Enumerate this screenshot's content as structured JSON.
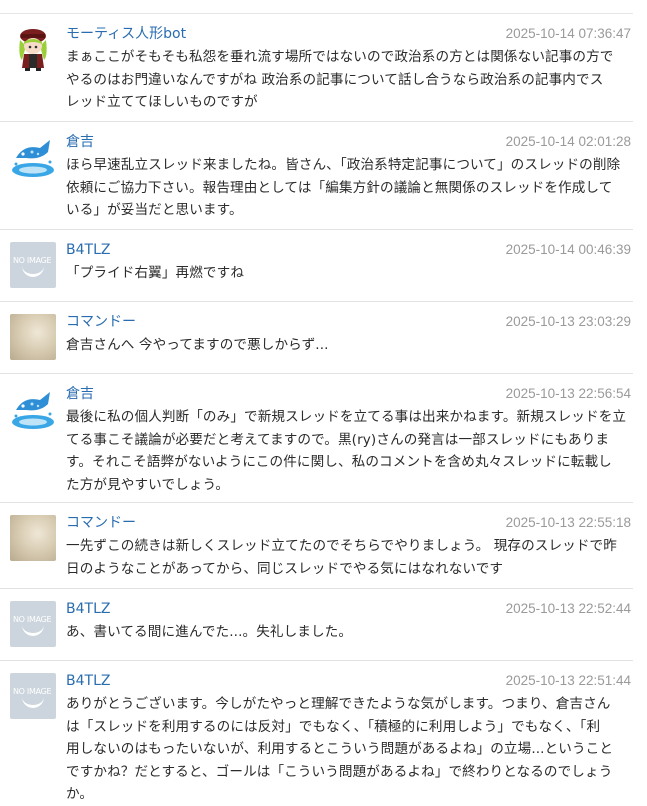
{
  "comments": [
    {
      "author": "モーティス人形bot",
      "avatar_icon": "doll-icon",
      "time": "2025-10-14 07:36:47",
      "lines": [
        "まぁここがそもそも私怨を垂れ流す場所ではないので政治系の方とは関係ない記事の方で",
        "やるのはお門違いなんですがね 政治系の記事について話し合うなら政治系の記事内でス",
        "レッド立ててほしいものですが"
      ]
    },
    {
      "author": "倉吉",
      "avatar_icon": "fish-splash-icon",
      "time": "2025-10-14 02:01:28",
      "lines": [
        "ほら早速乱立スレッド来ましたね。皆さん、「政治系特定記事について」のスレッドの削除",
        "依頼にご協力下さい。報告理由としては「編集方針の議論と無関係のスレッドを作成して",
        "いる」が妥当だと思います。"
      ]
    },
    {
      "author": "B4TLZ",
      "avatar_icon": "no-image-icon",
      "avatar_text": "NO IMAGE",
      "time": "2025-10-14 00:46:39",
      "lines": [
        "「プライド右翼」再燃ですね"
      ]
    },
    {
      "author": "コマンドー",
      "avatar_icon": "photo-avatar-icon",
      "time": "2025-10-13 23:03:29",
      "lines": [
        "倉吉さんへ 今やってますので悪しからず..."
      ]
    },
    {
      "author": "倉吉",
      "avatar_icon": "fish-splash-icon",
      "time": "2025-10-13 22:56:54",
      "lines": [
        "最後に私の個人判断「のみ」で新規スレッドを立てる事は出来かねます。新規スレッドを立",
        "てる事こそ議論が必要だと考えてますので。黒(ry)さんの発言は一部スレッドにもありま",
        "す。それこそ語弊がないようにこの件に関し、私のコメントを含め丸々スレッドに転載し",
        "た方が見やすいでしょう。"
      ]
    },
    {
      "author": "コマンドー",
      "avatar_icon": "photo-avatar-icon",
      "time": "2025-10-13 22:55:18",
      "lines": [
        "一先ずこの続きは新しくスレッド立てたのでそちらでやりましょう。 現存のスレッドで昨",
        "日のようなことがあってから、同じスレッドでやる気にはなれないです"
      ]
    },
    {
      "author": "B4TLZ",
      "avatar_icon": "no-image-icon",
      "avatar_text": "NO IMAGE",
      "time": "2025-10-13 22:52:44",
      "lines": [
        "あ、書いてる間に進んでた...。失礼しました。"
      ]
    },
    {
      "author": "B4TLZ",
      "avatar_icon": "no-image-icon",
      "avatar_text": "NO IMAGE",
      "time": "2025-10-13 22:51:44",
      "lines": [
        "ありがとうございます。今しがたやっと理解できたような気がします。つまり、倉吉さん",
        "は「スレッドを利用するのには反対」でもなく、「積極的に利用しよう」でもなく、「利",
        "用しないのはもったいないが、利用するとこういう問題があるよね」の立場...ということ",
        "ですかね？だとすると、ゴールは「こういう問題があるよね」で終わりとなるのでしょう",
        "か。"
      ]
    }
  ]
}
